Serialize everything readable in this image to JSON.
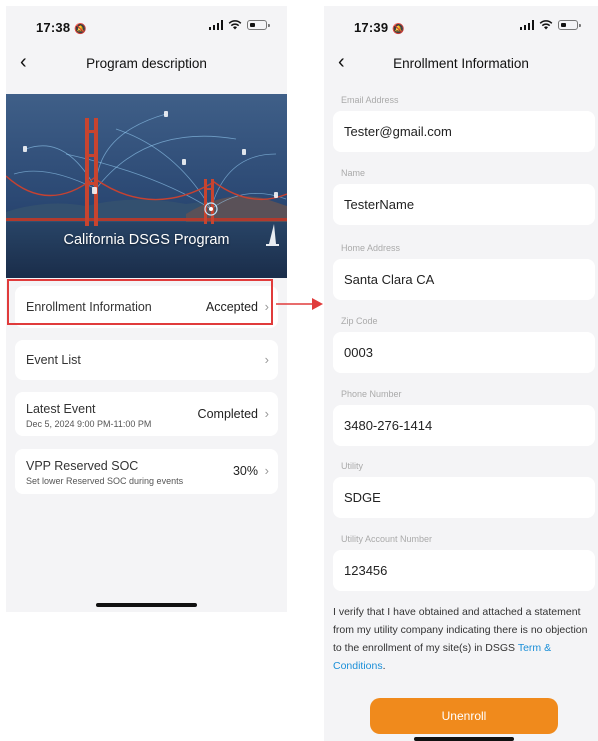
{
  "left_screen": {
    "status": {
      "time": "17:38"
    },
    "nav": {
      "title": "Program description"
    },
    "hero": {
      "title": "California DSGS Program"
    },
    "items": [
      {
        "label": "Enrollment Information",
        "value": "Accepted"
      },
      {
        "label": "Event List"
      },
      {
        "label": "Latest Event",
        "sublabel": "Dec 5, 2024 9:00 PM-11:00 PM",
        "value": "Completed"
      },
      {
        "label": "VPP Reserved SOC",
        "sublabel": "Set lower Reserved SOC during events",
        "value": "30%"
      }
    ]
  },
  "right_screen": {
    "status": {
      "time": "17:39"
    },
    "nav": {
      "title": "Enrollment Information"
    },
    "fields": [
      {
        "label": "Email Address",
        "value": "Tester@gmail.com"
      },
      {
        "label": "Name",
        "value": "TesterName"
      },
      {
        "label": "Home Address",
        "value": "Santa Clara CA"
      },
      {
        "label": "Zip Code",
        "value": "0003"
      },
      {
        "label": "Phone Number",
        "value": "3480-276-1414"
      },
      {
        "label": "Utility",
        "value": "SDGE"
      },
      {
        "label": "Utility Account Number",
        "value": "123456"
      }
    ],
    "verify_text": "I verify that I have obtained and attached a statement from my utility company indicating there is no objection to the enrollment of my site(s) in DSGS",
    "terms_link": "Term & Conditions",
    "unenroll_label": "Unenroll"
  },
  "icons": {
    "back": "chevron-left-icon",
    "row_chevron": "chevron-right-icon",
    "status": [
      "bell-slash-icon",
      "signal-icon",
      "wifi-icon",
      "battery-icon"
    ]
  },
  "colors": {
    "highlight": "#e03b3b",
    "link": "#1a8fd8",
    "unenroll_button": "#f08a1c",
    "screen_background": "#f4f4f6"
  }
}
